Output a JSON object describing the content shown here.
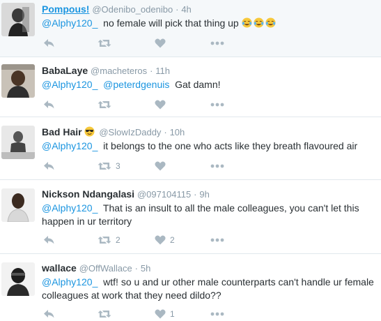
{
  "tweets": [
    {
      "name": "Pompous!",
      "handle": "@Odenibo_odenibo",
      "time": "4h",
      "mentions": [
        "@Alphy120_"
      ],
      "text": "no female will pick that thing up",
      "emoji": [
        "face-with-tears-of-joy",
        "face-with-tears-of-joy",
        "face-with-tears-of-joy"
      ],
      "retweets": "",
      "likes": ""
    },
    {
      "name": "BabaLaye",
      "handle": "@macheteros",
      "time": "11h",
      "mentions": [
        "@Alphy120_",
        "@peterdgenuis"
      ],
      "text": "Gat damn!",
      "retweets": "",
      "likes": ""
    },
    {
      "name": "Bad Hair",
      "name_emoji": "smiling-face-with-sunglasses",
      "handle": "@SlowIzDaddy",
      "time": "10h",
      "mentions": [
        "@Alphy120_"
      ],
      "text": "it belongs to the one who acts like they breath flavoured air",
      "retweets": "3",
      "likes": ""
    },
    {
      "name": "Nickson Ndangalasi",
      "handle": "@097104115",
      "time": "9h",
      "mentions": [
        "@Alphy120_"
      ],
      "text_line1": "That is an insult to all the male colleagues, you can't let this",
      "text_line2": "happen in ur territory",
      "retweets": "2",
      "likes": "2"
    },
    {
      "name": "wallace",
      "handle": "@OffWallace",
      "time": "5h",
      "mentions": [
        "@Alphy120_"
      ],
      "text_line1": "wtf! so u and ur other male counterparts can't handle ur female",
      "text_line2": "colleagues at work that they need dildo??",
      "retweets": "",
      "likes": "1"
    }
  ],
  "separator": "·",
  "icons": {
    "reply": "reply-arrow-icon",
    "retweet": "retweet-icon",
    "like": "heart-icon",
    "more": "more-dots-icon"
  },
  "colors": {
    "link": "#1b95e0",
    "muted": "#8899a6",
    "icon": "#aab8c2",
    "text": "#292f33",
    "highlight_bg": "#f5f8fa"
  }
}
